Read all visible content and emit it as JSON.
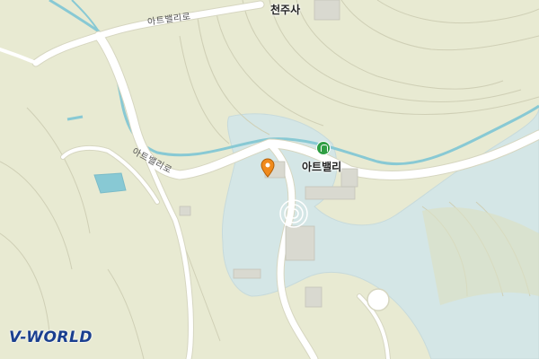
{
  "map": {
    "labels": {
      "temple": "천주사",
      "road_top": "아트밸리로",
      "road_mid": "아트밸리로",
      "poi": "아트밸리"
    },
    "logo_text": "V-WORLD",
    "colors": {
      "land": "#e8ead2",
      "water": "#d4e6e6",
      "stream": "#88c9d4",
      "road": "#ffffff",
      "contour": "#cfcfb5",
      "poi_green": "#2f9e44",
      "marker_orange": "#f08a1c",
      "logo_blue": "#1a3f8f"
    },
    "icons": {
      "poi": "park-icon",
      "marker": "location-pin-icon"
    }
  }
}
